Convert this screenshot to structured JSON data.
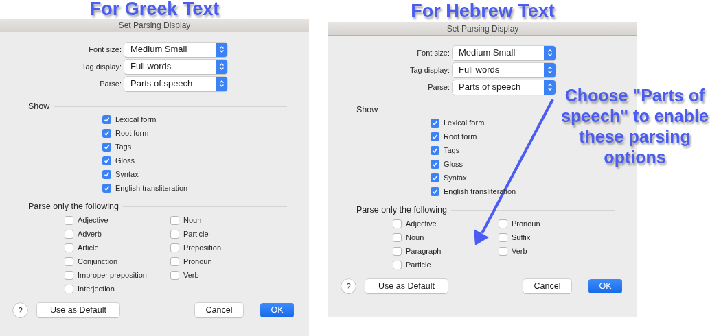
{
  "panels": [
    {
      "heading": "For Greek Text",
      "dialog": {
        "title": "Set Parsing Display",
        "fields": [
          {
            "label": "Font size:",
            "value": "Medium Small"
          },
          {
            "label": "Tag display:",
            "value": "Full words"
          },
          {
            "label": "Parse:",
            "value": "Parts of speech"
          }
        ],
        "show": {
          "title": "Show",
          "options": [
            {
              "label": "Lexical form",
              "checked": true
            },
            {
              "label": "Root form",
              "checked": true
            },
            {
              "label": "Tags",
              "checked": true
            },
            {
              "label": "Gloss",
              "checked": true
            },
            {
              "label": "Syntax",
              "checked": true
            },
            {
              "label": "English transliteration",
              "checked": true
            }
          ]
        },
        "parse": {
          "title": "Parse only the following",
          "columns": [
            [
              {
                "label": "Adjective",
                "checked": false
              },
              {
                "label": "Adverb",
                "checked": false
              },
              {
                "label": "Article",
                "checked": false
              },
              {
                "label": "Conjunction",
                "checked": false
              },
              {
                "label": "Improper preposition",
                "checked": false
              },
              {
                "label": "Interjection",
                "checked": false
              }
            ],
            [
              {
                "label": "Noun",
                "checked": false
              },
              {
                "label": "Particle",
                "checked": false
              },
              {
                "label": "Preposition",
                "checked": false
              },
              {
                "label": "Pronoun",
                "checked": false
              },
              {
                "label": "Verb",
                "checked": false
              }
            ]
          ]
        },
        "buttons": {
          "help": "?",
          "use_default": "Use as Default",
          "cancel": "Cancel",
          "ok": "OK"
        }
      }
    },
    {
      "heading": "For Hebrew Text",
      "dialog": {
        "title": "Set Parsing Display",
        "fields": [
          {
            "label": "Font size:",
            "value": "Medium Small"
          },
          {
            "label": "Tag display:",
            "value": "Full words"
          },
          {
            "label": "Parse:",
            "value": "Parts of speech"
          }
        ],
        "show": {
          "title": "Show",
          "options": [
            {
              "label": "Lexical form",
              "checked": true
            },
            {
              "label": "Root form",
              "checked": true
            },
            {
              "label": "Tags",
              "checked": true
            },
            {
              "label": "Gloss",
              "checked": true
            },
            {
              "label": "Syntax",
              "checked": true
            },
            {
              "label": "English transliteration",
              "checked": true
            }
          ]
        },
        "parse": {
          "title": "Parse only the following",
          "columns": [
            [
              {
                "label": "Adjective",
                "checked": false
              },
              {
                "label": "Noun",
                "checked": false
              },
              {
                "label": "Paragraph",
                "checked": false
              },
              {
                "label": "Particle",
                "checked": false
              }
            ],
            [
              {
                "label": "Pronoun",
                "checked": false
              },
              {
                "label": "Suffix",
                "checked": false
              },
              {
                "label": "Verb",
                "checked": false
              }
            ]
          ]
        },
        "buttons": {
          "help": "?",
          "use_default": "Use as Default",
          "cancel": "Cancel",
          "ok": "OK"
        }
      }
    }
  ],
  "callout": {
    "text": "Choose \"Parts of speech\" to enable these parsing options"
  }
}
